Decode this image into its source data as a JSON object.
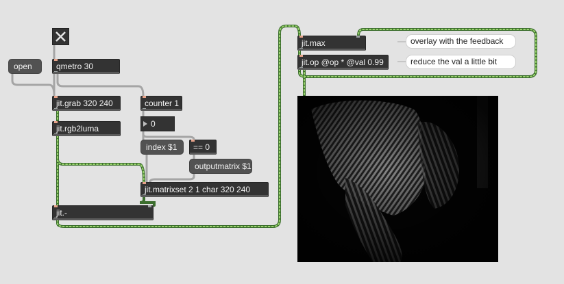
{
  "patch": {
    "objects": {
      "qmetro": "qmetro 30",
      "jit_grab": "jit.grab 320 240",
      "counter": "counter 1",
      "jit_rgb2luma": "jit.rgb2luma",
      "jit_matrixset": "jit.matrixset 2 1 char 320 240",
      "jit_minus": "jit.-",
      "jit_max": "jit.max",
      "jit_op": "jit.op @op * @val 0.99"
    },
    "messages": {
      "open": "open",
      "index": "index $1",
      "equals_zero": "== 0",
      "outputmatrix": "outputmatrix $1"
    },
    "number_box": {
      "value": "0"
    },
    "toggle": {
      "state": "on"
    },
    "comments": {
      "overlay": "overlay with the feedback",
      "reduce": "reduce the val a little bit"
    },
    "jit_pwindow": {
      "content": "feedback motion-trail video image"
    }
  },
  "colors": {
    "background": "#e3e3e3",
    "object_bg": "#333333",
    "message_bg": "#525252",
    "patch_cord": "#a5a5a5",
    "matrix_cord": "#3c6e2e",
    "matrix_cord_dash": "#9bd46e"
  },
  "icons": {
    "toggle": "x-mark-icon",
    "number_arrow": "triangle-right-icon"
  }
}
